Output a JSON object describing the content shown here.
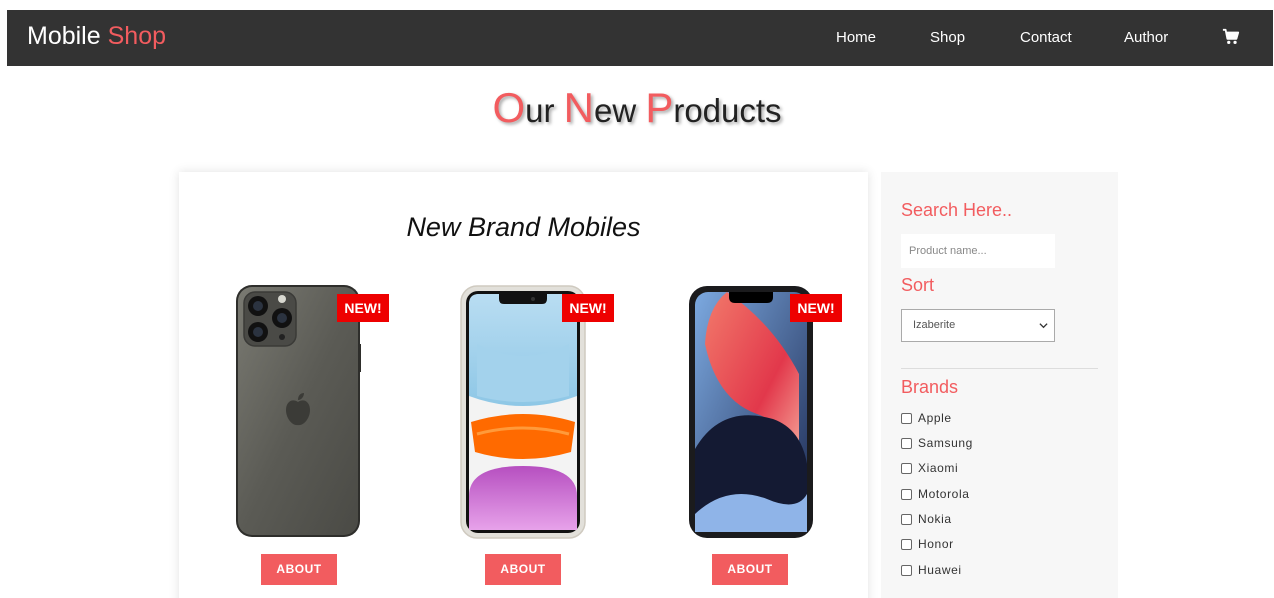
{
  "navbar": {
    "brand_main": "Mobile",
    "brand_accent": "Shop",
    "links": [
      "Home",
      "Shop",
      "Contact",
      "Author"
    ],
    "cart_icon": "shopping-cart-icon"
  },
  "page_title": {
    "w1_first": "O",
    "w1_rest": "ur",
    "w2_first": "N",
    "w2_rest": "ew",
    "w3_first": "P",
    "w3_rest": "roducts"
  },
  "products_section": {
    "title": "New Brand Mobiles",
    "products": [
      {
        "badge": "NEW!",
        "button": "ABOUT"
      },
      {
        "badge": "NEW!",
        "button": "ABOUT"
      },
      {
        "badge": "NEW!",
        "button": "ABOUT"
      }
    ]
  },
  "sidebar": {
    "search_heading": "Search Here..",
    "search_placeholder": "Product name...",
    "sort_heading": "Sort",
    "sort_selected": "Izaberite",
    "brands_heading": "Brands",
    "brands": [
      "Apple",
      "Samsung",
      "Xiaomi",
      "Motorola",
      "Nokia",
      "Honor",
      "Huawei"
    ]
  },
  "colors": {
    "accent": "#f25c5f",
    "navbar_bg": "#333333",
    "badge_bg": "#ee0000"
  }
}
